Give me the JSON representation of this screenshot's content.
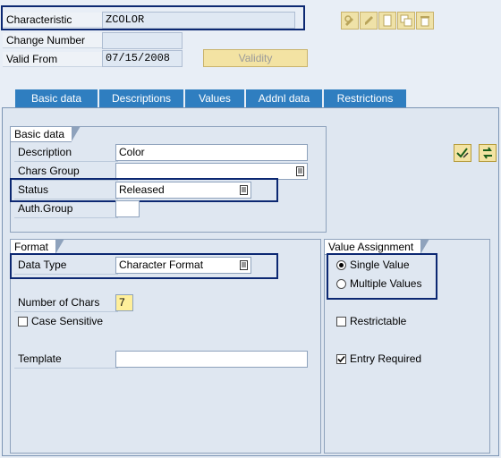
{
  "header": {
    "characteristic_label": "Characteristic",
    "characteristic_value": "ZCOLOR",
    "change_number_label": "Change Number",
    "change_number_value": "",
    "valid_from_label": "Valid From",
    "valid_from_value": "07/15/2008",
    "validity_button": "Validity"
  },
  "toolbar_icons": [
    "display-change-icon",
    "edit-icon",
    "create-icon",
    "copy-icon",
    "delete-icon"
  ],
  "tabs": [
    {
      "label": "Basic data",
      "active": true
    },
    {
      "label": "Descriptions",
      "active": false
    },
    {
      "label": "Values",
      "active": false
    },
    {
      "label": "Addnl data",
      "active": false
    },
    {
      "label": "Restrictions",
      "active": false
    }
  ],
  "basic_data": {
    "title": "Basic data",
    "description_label": "Description",
    "description_value": "Color",
    "chars_group_label": "Chars Group",
    "chars_group_value": "",
    "status_label": "Status",
    "status_value": "Released",
    "auth_group_label": "Auth.Group",
    "auth_group_value": ""
  },
  "format": {
    "title": "Format",
    "data_type_label": "Data Type",
    "data_type_value": "Character Format",
    "num_chars_label": "Number of Chars",
    "num_chars_value": "7",
    "case_sensitive_label": "Case Sensitive",
    "case_sensitive_checked": false,
    "template_label": "Template",
    "template_value": ""
  },
  "value_assignment": {
    "title": "Value Assignment",
    "single_value_label": "Single Value",
    "single_value_selected": true,
    "multiple_values_label": "Multiple Values",
    "multiple_values_selected": false,
    "restrictable_label": "Restrictable",
    "restrictable_checked": false,
    "entry_required_label": "Entry Required",
    "entry_required_checked": true
  },
  "colors": {
    "tab_blue": "#2f7ec0",
    "highlight_border": "#0c2872",
    "button_yellow": "#f3e3a3"
  }
}
